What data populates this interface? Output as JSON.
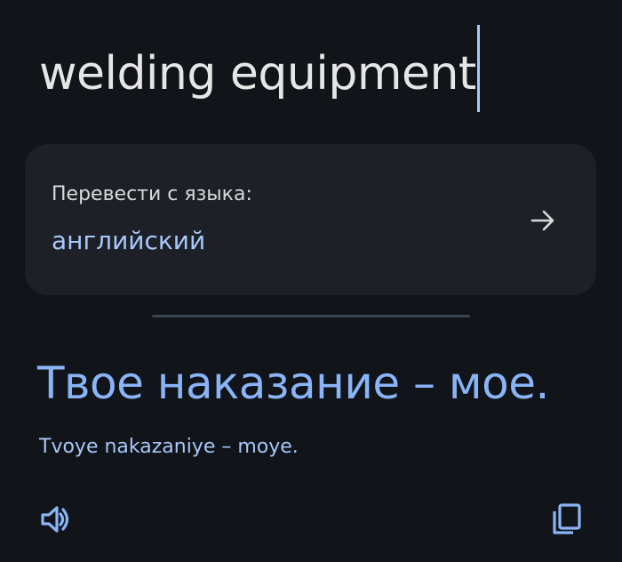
{
  "source": {
    "text": "welding equipment"
  },
  "language_card": {
    "label": "Перевести с языка:",
    "language": "английский"
  },
  "result": {
    "translation": "Твое наказание – мое.",
    "transliteration": "Tvoye nakazaniye – moye."
  },
  "icons": {
    "arrow": "arrow-right-icon",
    "speaker": "speaker-icon",
    "copy": "copy-icon"
  },
  "colors": {
    "background": "#111419",
    "card": "#1d2026",
    "accent": "#8ab4f8",
    "caret": "#a8c7fa"
  }
}
